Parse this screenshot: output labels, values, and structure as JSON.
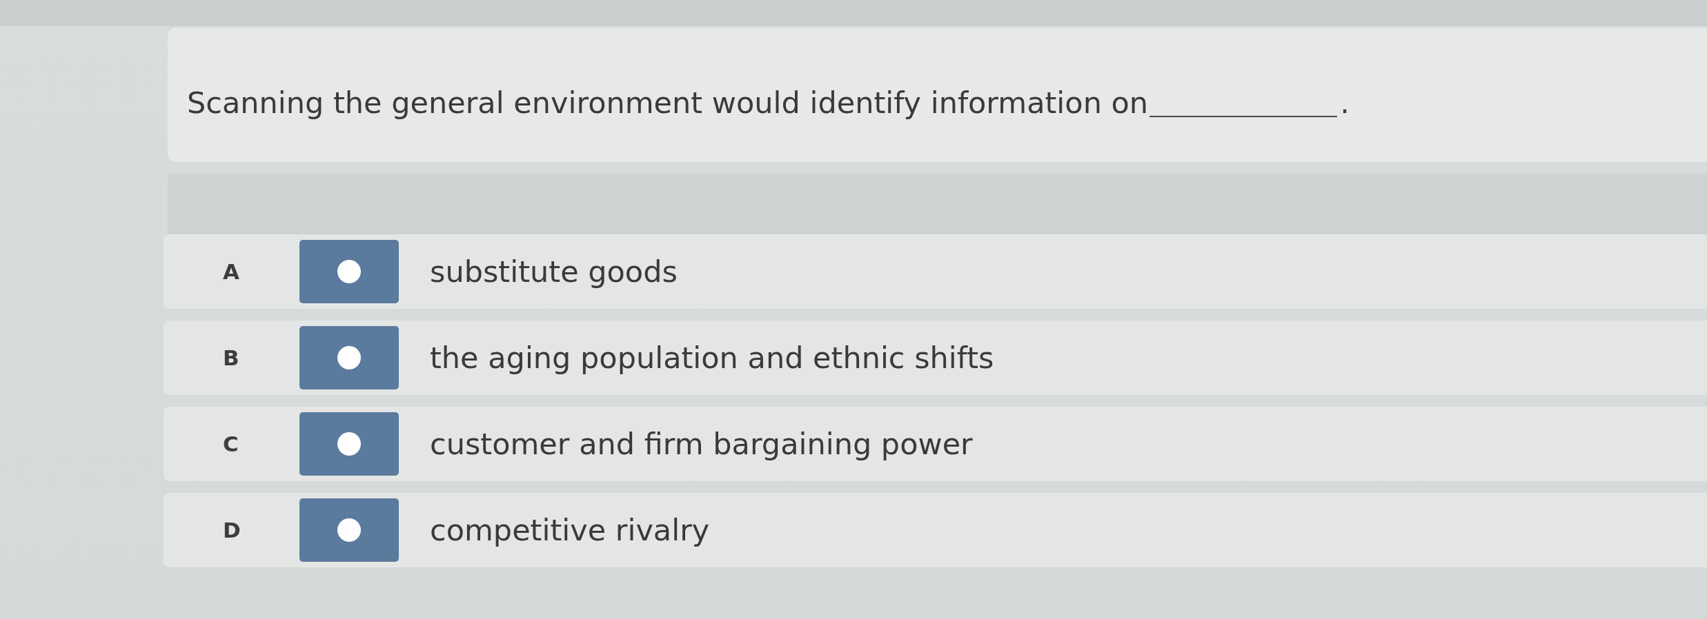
{
  "question": {
    "text": "Scanning the general environment would identify information on",
    "ending": "."
  },
  "options": [
    {
      "letter": "A",
      "text": "substitute goods",
      "selected": false
    },
    {
      "letter": "B",
      "text": "the aging population and ethnic shifts",
      "selected": false
    },
    {
      "letter": "C",
      "text": "customer and firm bargaining power",
      "selected": false
    },
    {
      "letter": "D",
      "text": "competitive rivalry",
      "selected": false
    }
  ]
}
